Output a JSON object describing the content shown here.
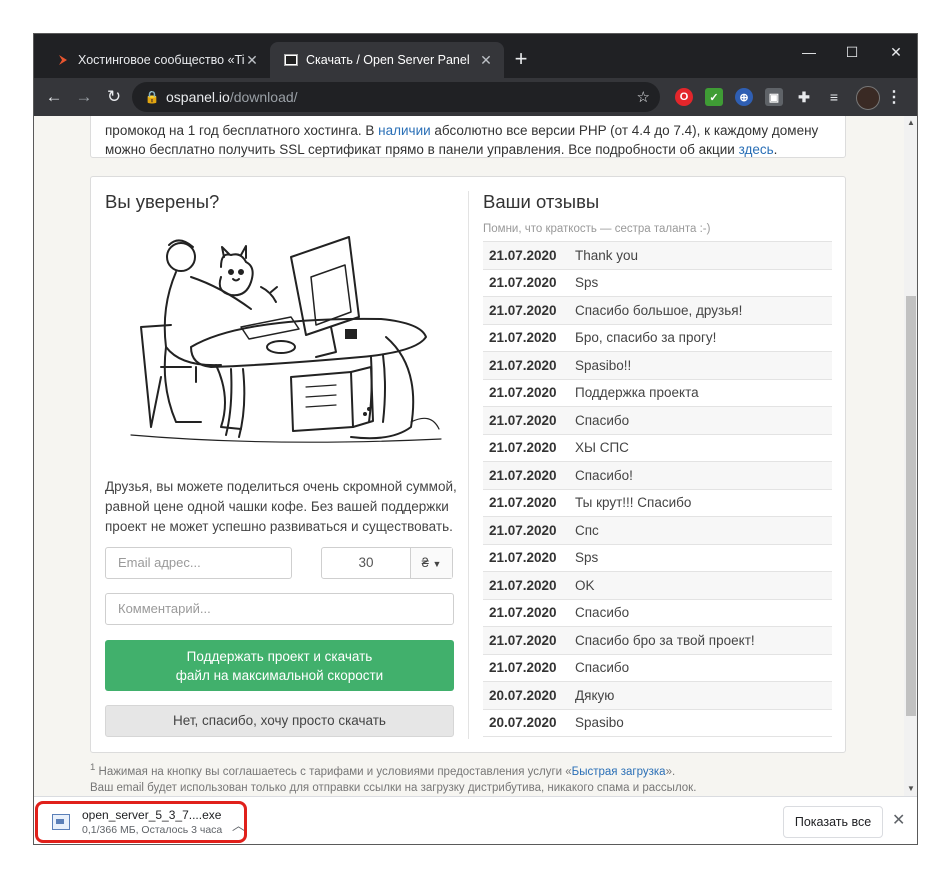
{
  "browser": {
    "tabs": [
      {
        "title": "Хостинговое сообщество «Time",
        "active": false
      },
      {
        "title": "Скачать / Open Server Panel",
        "active": true
      }
    ],
    "new_tab_icon": "plus-icon",
    "url_host": "ospanel.io",
    "url_path": "/download/",
    "window_controls": [
      "minimize-icon",
      "maximize-icon",
      "close-icon"
    ]
  },
  "promo": {
    "text_1": "промокод на 1 год бесплатного хостинга. В ",
    "link_1": "наличии",
    "text_2": " абсолютно все версии PHP (от 4.4 до 7.4), к каждому домену можно бесплатно получить SSL сертификат прямо в панели управления. Все подробности об акции ",
    "link_2": "здесь",
    "text_3": "."
  },
  "donate": {
    "heading": "Вы уверены?",
    "paragraph": "Друзья, вы можете поделиться очень скромной суммой, равной цене одной чашки кофе. Без вашей поддержки проект не может успешно развиваться и существовать.",
    "email_placeholder": "Email адрес...",
    "amount": "30",
    "currency": "₴",
    "comment_placeholder": "Комментарий...",
    "support_button_line1": "Поддержать проект и скачать",
    "support_button_line2": "файл на максимальной скорости",
    "skip_button": "Нет, спасибо, хочу просто скачать"
  },
  "reviews": {
    "heading": "Ваши отзывы",
    "hint": "Помни, что краткость — сестра таланта :-)",
    "items": [
      {
        "date": "21.07.2020",
        "text": "Thank you"
      },
      {
        "date": "21.07.2020",
        "text": "Sps"
      },
      {
        "date": "21.07.2020",
        "text": "Спасибо большое, друзья!"
      },
      {
        "date": "21.07.2020",
        "text": "Бро, спасибо за прогу!"
      },
      {
        "date": "21.07.2020",
        "text": "Spasibo!!"
      },
      {
        "date": "21.07.2020",
        "text": "Поддержка проекта"
      },
      {
        "date": "21.07.2020",
        "text": "Спасибо"
      },
      {
        "date": "21.07.2020",
        "text": "ХЫ СПС"
      },
      {
        "date": "21.07.2020",
        "text": "Спасибо!"
      },
      {
        "date": "21.07.2020",
        "text": "Ты крут!!! Спасибо"
      },
      {
        "date": "21.07.2020",
        "text": "Спс"
      },
      {
        "date": "21.07.2020",
        "text": "Sps"
      },
      {
        "date": "21.07.2020",
        "text": "OK"
      },
      {
        "date": "21.07.2020",
        "text": "Спасибо"
      },
      {
        "date": "21.07.2020",
        "text": "Спасибо бро за твой проект!"
      },
      {
        "date": "21.07.2020",
        "text": "Спасибо"
      },
      {
        "date": "20.07.2020",
        "text": "Дякую"
      },
      {
        "date": "20.07.2020",
        "text": "Spasibo"
      }
    ]
  },
  "footnote": {
    "line1_prefix": "Нажимая на кнопку вы соглашаетесь с тарифами и условиями предоставления услуги «",
    "line1_link": "Быстрая загрузка",
    "line1_suffix": "».",
    "line2": "Ваш email будет использован только для отправки ссылки на загрузку дистрибутива, никакого спама и рассылок."
  },
  "download_bar": {
    "file_name": "open_server_5_3_7....exe",
    "status": "0,1/366 МБ, Осталось 3 часа",
    "show_all": "Показать все"
  }
}
